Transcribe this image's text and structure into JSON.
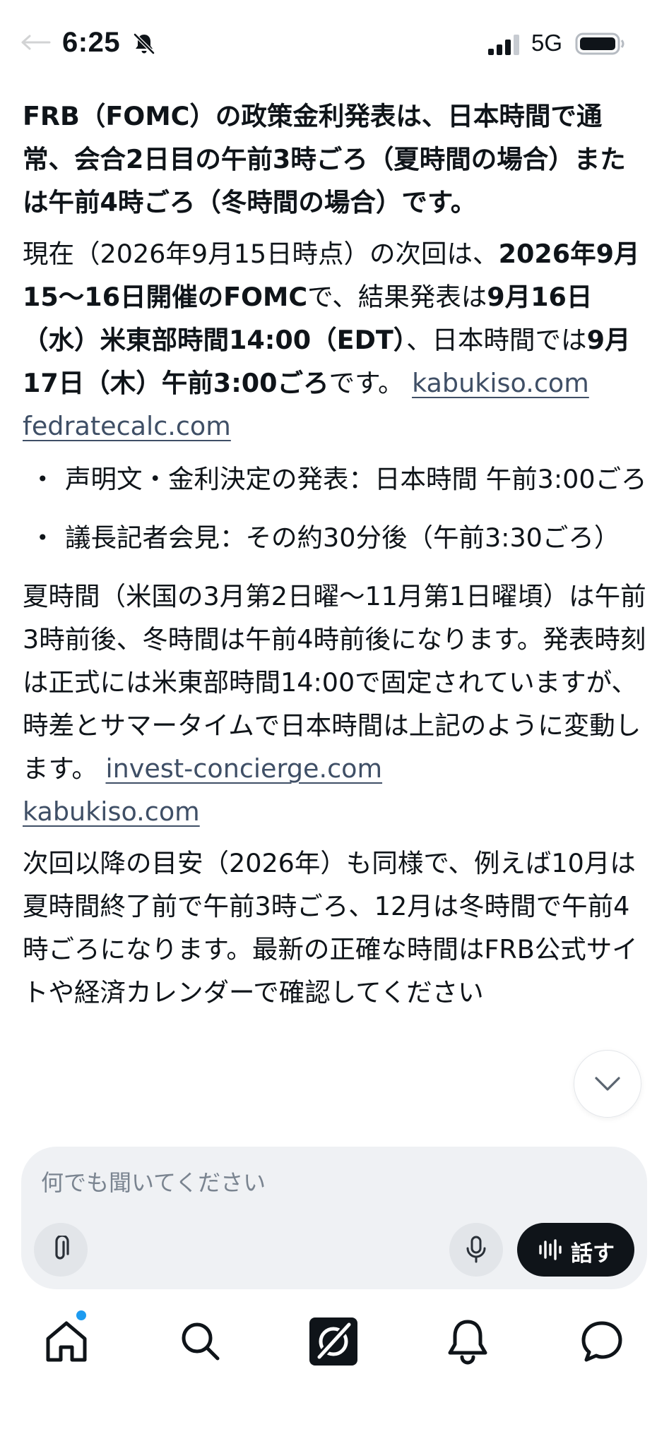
{
  "status_bar": {
    "time": "6:25",
    "network": "5G"
  },
  "article": {
    "p1": "FRB（FOMC）の政策金利発表は、日本時間で通常、会合2日目の午前3時ごろ（夏時間の場合）または午前4時ごろ（冬時間の場合）です。",
    "p2": {
      "t1": "現在（2026年9月15日時点）の次回は、",
      "b1": "2026年9月15〜16日開催のFOMC",
      "t2": "で、結果発表は",
      "b2": "9月16日（水）米東部時間14:00（EDT）",
      "t3": "、日本時間では",
      "b3": "9月17日（木）午前3:00ごろ",
      "t4": "です。",
      "link1": "kabukiso.com",
      "link2": "fedratecalc.com"
    },
    "bullets": [
      {
        "text": "声明文・金利決定の発表：日本時間 午前3:00ごろ"
      },
      {
        "text": "議長記者会見：その約30分後（午前3:30ごろ）"
      }
    ],
    "p3": {
      "text": "夏時間（米国の3月第2日曜〜11月第1日曜頃）は午前3時前後、冬時間は午前4時前後になります。発表時刻は正式には米東部時間14:00で固定されていますが、時差とサマータイムで日本時間は上記のように変動します。",
      "link1": "invest-concierge.com",
      "link2": "kabukiso.com"
    },
    "p4": "次回以降の目安（2026年）も同様で、例えば10月は夏時間終了前で午前3時ごろ、12月は冬時間で午前4時ごろになります。最新の正確な時間はFRB公式サイトや経済カレンダーで確認してください"
  },
  "composer": {
    "placeholder": "何でも聞いてください",
    "talk_label": "話す"
  },
  "tabbar": {
    "items": [
      {
        "icon": "home-icon",
        "has_badge": true
      },
      {
        "icon": "search-icon"
      },
      {
        "icon": "grok-icon"
      },
      {
        "icon": "bell-icon"
      },
      {
        "icon": "chat-icon"
      }
    ],
    "badge_color": "#1d9bf0"
  }
}
